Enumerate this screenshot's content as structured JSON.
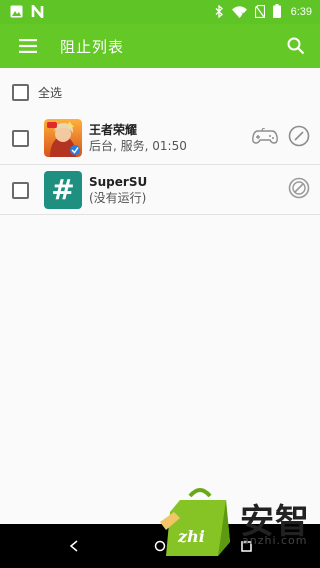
{
  "status_bar": {
    "time": "6:39",
    "icons": [
      "gallery-icon",
      "n-icon",
      "bluetooth-icon",
      "wifi-icon",
      "no-sim-icon",
      "battery-icon"
    ]
  },
  "app_bar": {
    "title": "阻止列表",
    "menu_icon": "menu-icon",
    "search_icon": "search-icon"
  },
  "list": {
    "select_all_label": "全选",
    "items": [
      {
        "name": "王者荣耀",
        "status": "后台, 服务, 01:50",
        "icon": "honor-of-kings-app-icon",
        "extra_icon": "gamepad-icon",
        "action_icon": "block-icon",
        "checked": false
      },
      {
        "name": "SuperSU",
        "status": "(没有运行)",
        "icon": "supersu-app-icon",
        "icon_glyph": "#",
        "action_icon": "block-icon",
        "checked": false
      }
    ]
  },
  "watermark": {
    "brand": "安智",
    "domain": "anzhi.com",
    "mascot_text": "zhi"
  },
  "colors": {
    "accent": "#64c827",
    "status_bar": "#5fc425",
    "supersu_bg": "#1f8f80"
  }
}
